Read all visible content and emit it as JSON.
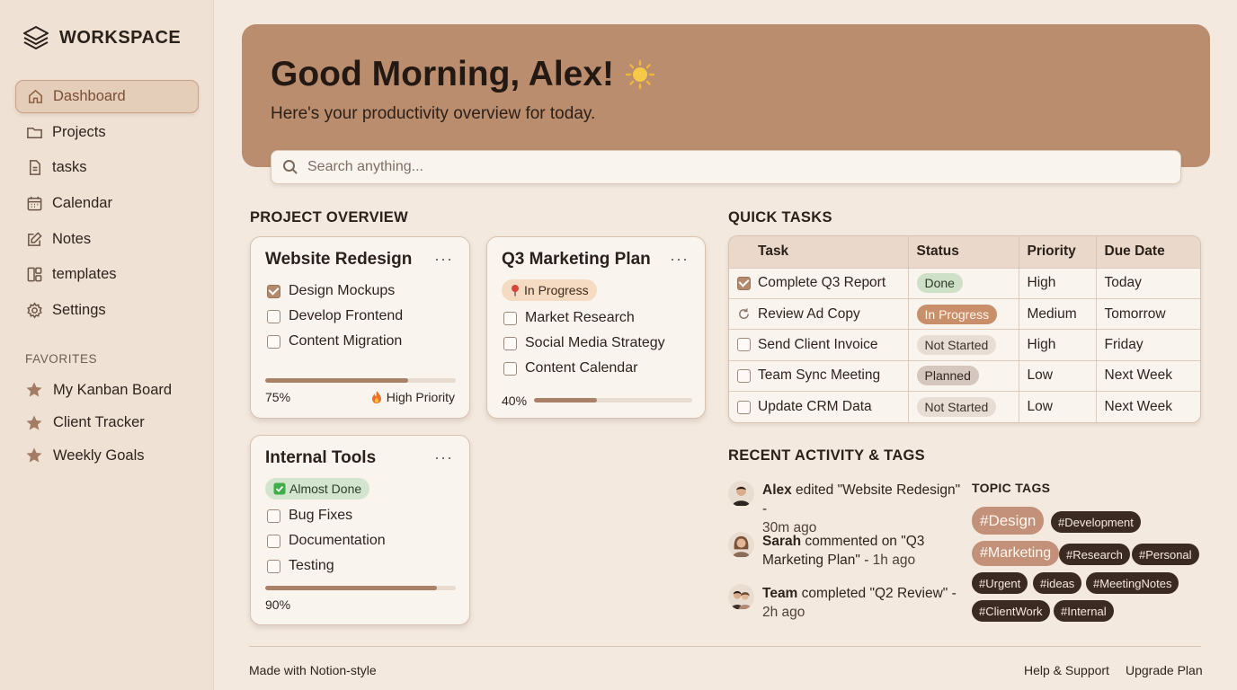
{
  "app": {
    "brand": "WORKSPACE"
  },
  "sidebar": {
    "items": [
      {
        "label": "Dashboard",
        "icon": "home-icon",
        "active": true
      },
      {
        "label": "Projects",
        "icon": "folder-icon"
      },
      {
        "label": "tasks",
        "icon": "document-icon"
      },
      {
        "label": "Calendar",
        "icon": "calendar-icon"
      },
      {
        "label": "Notes",
        "icon": "edit-icon"
      },
      {
        "label": "templates",
        "icon": "template-icon"
      },
      {
        "label": "Settings",
        "icon": "gear-icon"
      }
    ],
    "favorites_title": "FAVORITES",
    "favorites": [
      {
        "label": "My Kanban Board",
        "icon": "star-icon"
      },
      {
        "label": "Client Tracker",
        "icon": "star-icon"
      },
      {
        "label": "Weekly Goals",
        "icon": "star-icon"
      }
    ]
  },
  "hero": {
    "title": "Good Morning, Alex!",
    "subtitle": "Here's your productivity overview for today.",
    "icon": "sun-icon"
  },
  "search": {
    "placeholder": "Search anything..."
  },
  "project_overview": {
    "title": "PROJECT OVERVIEW",
    "menu": "···",
    "cards": [
      {
        "title": "Website Redesign",
        "items": [
          {
            "label": "Design Mockups",
            "checked": true
          },
          {
            "label": "Develop Frontend",
            "checked": false
          },
          {
            "label": "Content Migration",
            "checked": false
          }
        ],
        "progress": 75,
        "progress_label": "75%",
        "priority": "High Priority",
        "priority_icon": "fire-icon"
      },
      {
        "title": "Q3 Marketing Plan",
        "status": "In Progress",
        "status_icon": "pin-icon",
        "items": [
          {
            "label": "Market Research",
            "checked": false
          },
          {
            "label": "Social Media Strategy",
            "checked": false
          },
          {
            "label": "Content Calendar",
            "checked": false
          }
        ],
        "progress": 40,
        "progress_label": "40%"
      },
      {
        "title": "Internal Tools",
        "status": "Almost Done",
        "status_icon": "check-box-icon",
        "items": [
          {
            "label": "Bug Fixes",
            "checked": false
          },
          {
            "label": "Documentation",
            "checked": false
          },
          {
            "label": "Testing",
            "checked": false
          }
        ],
        "progress": 90,
        "progress_label": "90%"
      }
    ]
  },
  "quick_tasks": {
    "title": "QUICK TASKS",
    "headers": [
      "Task",
      "Status",
      "Priority",
      "Due Date"
    ],
    "rows": [
      {
        "task": "Complete Q3 Report",
        "state": "checked",
        "status": "Done",
        "status_kind": "done",
        "priority": "High",
        "due": "Today"
      },
      {
        "task": "Review Ad Copy",
        "state": "refresh",
        "status": "In Progress",
        "status_kind": "inprog",
        "priority": "Medium",
        "due": "Tomorrow"
      },
      {
        "task": "Send Client Invoice",
        "state": "unchecked",
        "status": "Not Started",
        "status_kind": "notstarted",
        "priority": "High",
        "due": "Friday"
      },
      {
        "task": "Team Sync Meeting",
        "state": "unchecked",
        "status": "Planned",
        "status_kind": "planned",
        "priority": "Low",
        "due": "Next Week"
      },
      {
        "task": "Update CRM Data",
        "state": "unchecked",
        "status": "Not Started",
        "status_kind": "notstarted",
        "priority": "Low",
        "due": "Next Week"
      }
    ]
  },
  "activity": {
    "title": "RECENT ACTIVITY & TAGS",
    "items": [
      {
        "who": "Alex",
        "text": " edited \"Website Redesign\" -",
        "time": "30m ago"
      },
      {
        "who": "Sarah",
        "text": " commented on \"Q3 Marketing Plan\" -",
        "time": "1h ago"
      },
      {
        "who": "Team",
        "text": " completed \"Q2 Review\" -",
        "time": "2h ago"
      }
    ]
  },
  "tags": {
    "title": "TOPIC TAGS",
    "items": [
      "#Design",
      "#Development",
      "#Marketing",
      "#Research",
      "#Personal",
      "#Urgent",
      "#ideas",
      "#MeetingNotes",
      "#ClientWork",
      "#Internal"
    ]
  },
  "footer": {
    "left": "Made with Notion-style",
    "links": [
      "Help & Support",
      "Upgrade Plan"
    ]
  }
}
